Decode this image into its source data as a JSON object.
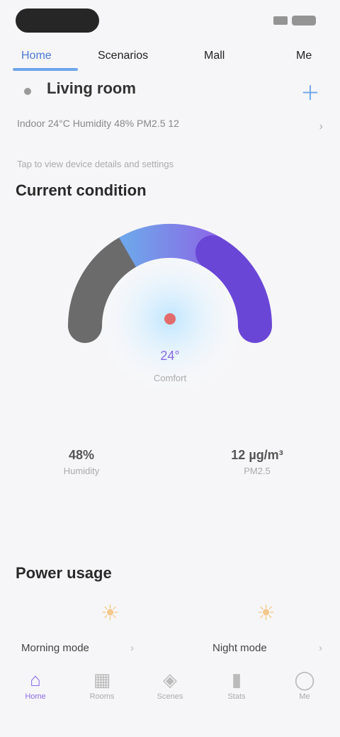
{
  "status": {
    "time": ""
  },
  "tabs": [
    {
      "label": "Home",
      "active": true
    },
    {
      "label": "Scenarios",
      "active": false
    },
    {
      "label": "Mall",
      "active": false
    },
    {
      "label": "Me",
      "active": false
    }
  ],
  "device": {
    "name": "Living room",
    "plus_icon": "plus-icon"
  },
  "subline": "Indoor 24°C  Humidity 48%  PM2.5 12",
  "hint": "Tap to view device details and settings",
  "sections": {
    "climate": "Current condition",
    "energy": "Power usage"
  },
  "gauge": {
    "center_value": "24°",
    "center_label": "Comfort",
    "level": 0.5,
    "colors": {
      "off": "#6b6b6b",
      "mid": "#7aa7f0",
      "high": "#6a46d6"
    }
  },
  "stats": [
    {
      "value": "48%",
      "label": "Humidity"
    },
    {
      "value": "12 µg/m³",
      "label": "PM2.5"
    }
  ],
  "cards": [
    {
      "label": "Morning mode",
      "icon": "sun-icon"
    },
    {
      "label": "Night mode",
      "icon": "sun-icon"
    }
  ],
  "nav": [
    {
      "label": "Home",
      "icon": "home-icon",
      "active": true
    },
    {
      "label": "Rooms",
      "icon": "grid-icon",
      "active": false
    },
    {
      "label": "Scenes",
      "icon": "scene-icon",
      "active": false
    },
    {
      "label": "Stats",
      "icon": "chart-icon",
      "active": false
    },
    {
      "label": "Me",
      "icon": "user-icon",
      "active": false
    }
  ]
}
